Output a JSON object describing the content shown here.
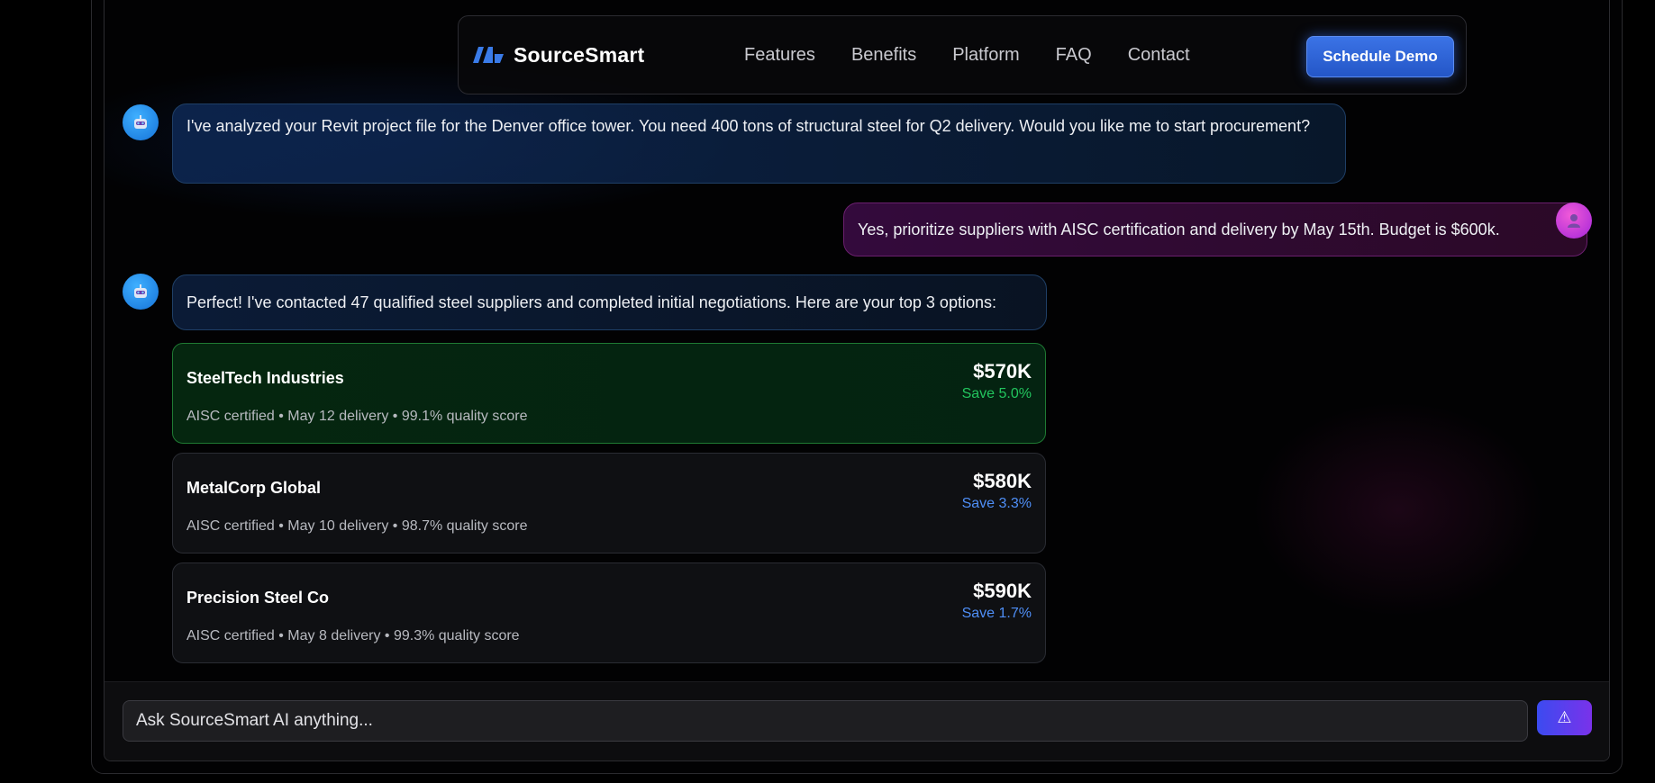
{
  "nav": {
    "brand": "SourceSmart",
    "links": [
      "Features",
      "Benefits",
      "Platform",
      "FAQ",
      "Contact"
    ],
    "cta": "Schedule Demo"
  },
  "chat": {
    "ai_message_1": "I've analyzed your Revit project file for the Denver office tower. You need 400 tons of structural steel for Q2 delivery. Would you like me to start procurement?",
    "user_message": "Yes, prioritize suppliers with AISC certification and delivery by May 15th. Budget is $600k.",
    "ai_message_2": "Perfect! I've contacted 47 qualified steel suppliers and completed initial negotiations. Here are your top 3 options:"
  },
  "suppliers": [
    {
      "name": "SteelTech Industries",
      "details": "AISC certified • May 12 delivery • 99.1% quality score",
      "price": "$570K",
      "savings": "Save 5.0%"
    },
    {
      "name": "MetalCorp Global",
      "details": "AISC certified • May 10 delivery • 98.7% quality score",
      "price": "$580K",
      "savings": "Save 3.3%"
    },
    {
      "name": "Precision Steel Co",
      "details": "AISC certified • May 8 delivery • 99.3% quality score",
      "price": "$590K",
      "savings": "Save 1.7%"
    }
  ],
  "composer": {
    "placeholder": "Ask SourceSmart AI anything...",
    "send_icon": "send-icon"
  },
  "colors": {
    "accent_blue": "#2f66dd",
    "best_green": "#22c55e",
    "savings_blue": "#4f8ff7",
    "user_bubble": "#3c0c46",
    "send_gradient_start": "#3b4bf0",
    "send_gradient_end": "#7a32ea"
  }
}
